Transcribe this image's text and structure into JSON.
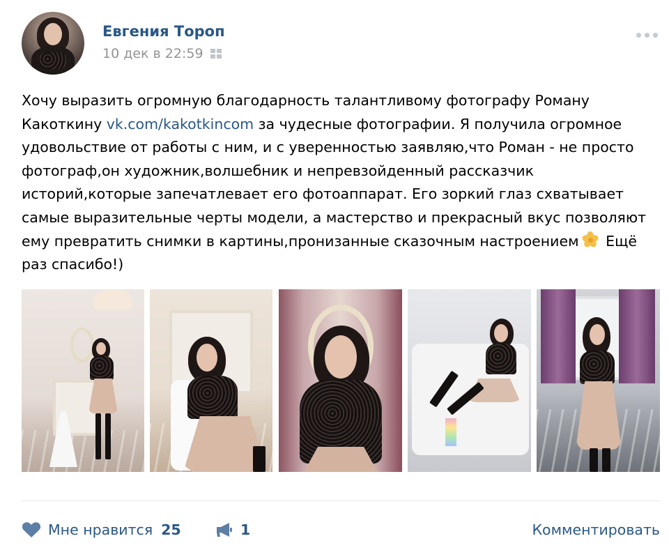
{
  "post": {
    "author": "Евгения Тороп",
    "timestamp": "10 дек в 22:59",
    "platform_icon": "windows-icon",
    "text_parts": {
      "before_link": "Хочу выразить огромную благодарность талантливому фотографу Роману Какоткину ",
      "link": "vk.com/kakotkincom",
      "after_link": " за чудесные фотографии. Я получила огромное удовольствие от работы с ним, и с уверенностью заявляю,что Роман - не просто фотограф,он художник,волшебник и непревзойденный рассказчик историй,которые запечатлевает его фотоаппарат. Его зоркий глаз схватывает самые выразительные черты модели, а мастерство и прекрасный вкус позволяют ему превратить снимки в картины,пронизанные сказочным настроением",
      "emoji": "flower-emoji",
      "after_emoji": " Ещё раз спасибо!)"
    },
    "photos_count": 5
  },
  "footer": {
    "like_label": "Мне нравится",
    "like_count": "25",
    "share_count": "1",
    "comment_label": "Комментировать"
  },
  "colors": {
    "link": "#2a5885",
    "meta": "#939393",
    "divider": "#e7e8ec",
    "icon": "#5d7ea5"
  }
}
